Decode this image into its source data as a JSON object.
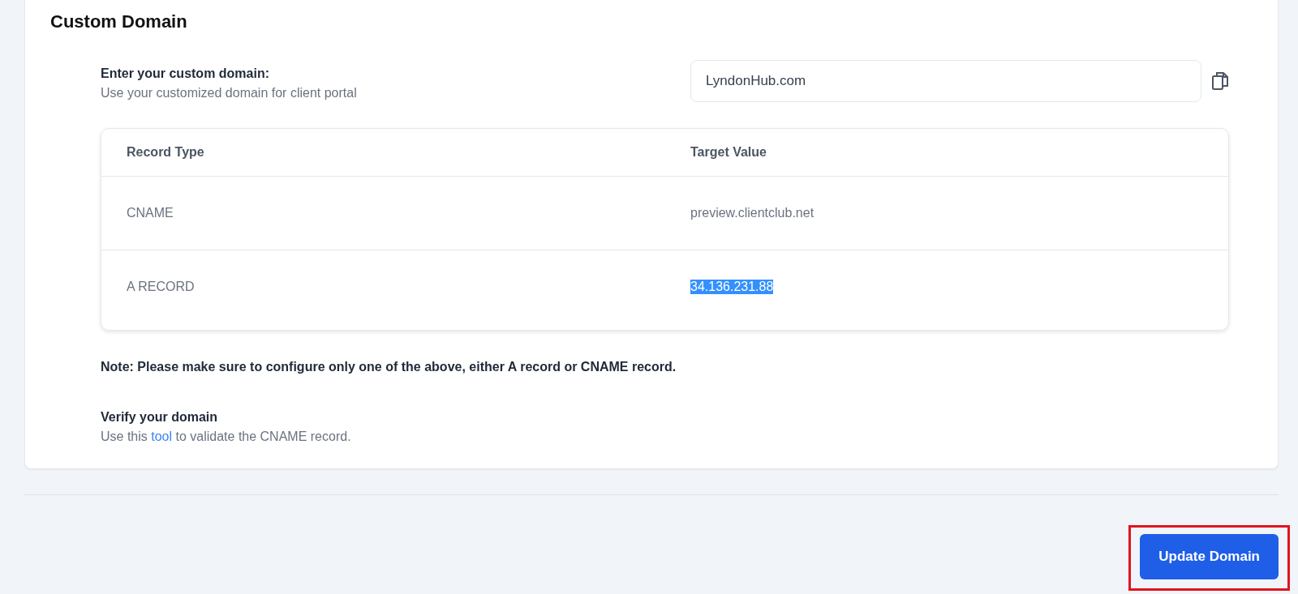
{
  "section": {
    "title": "Custom Domain"
  },
  "domain_field": {
    "label": "Enter your custom domain:",
    "description": "Use your customized domain for client portal",
    "value": "LyndonHub.com"
  },
  "table": {
    "columns": [
      "Record Type",
      "Target Value"
    ],
    "rows": [
      {
        "record_type": "CNAME",
        "target_value": "preview.clientclub.net",
        "value_selected": false
      },
      {
        "record_type": "A RECORD",
        "target_value": "34.136.231.88",
        "value_selected": true
      }
    ]
  },
  "note": "Note: Please make sure to configure only one of the above, either A record or CNAME record.",
  "verify": {
    "title": "Verify your domain",
    "text_before": "Use this ",
    "link": "tool",
    "text_after": " to validate the CNAME record."
  },
  "footer": {
    "button": "Update Domain",
    "highlighted": true
  }
}
